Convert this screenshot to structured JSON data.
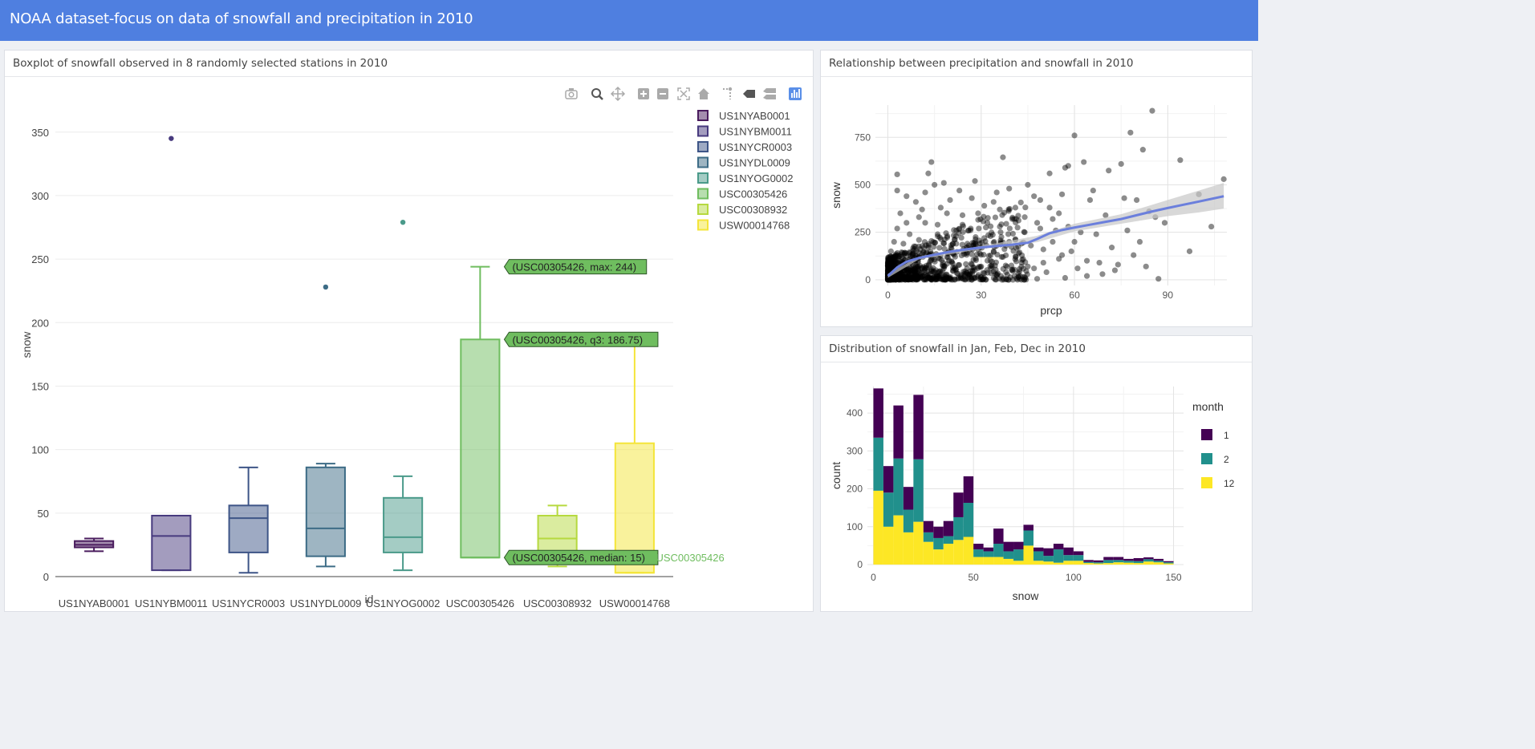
{
  "header": {
    "title": "NOAA dataset-focus on data of snowfall and precipitation in 2010"
  },
  "panels": {
    "boxplot": {
      "title": "Boxplot of snowfall observed in 8 randomly selected stations in 2010"
    },
    "scatter": {
      "title": "Relationship between precipitation and snowfall in 2010"
    },
    "histogram": {
      "title": "Distribution of snowfall in Jan, Feb, Dec in 2010"
    }
  },
  "modebar": {
    "buttons": [
      "camera-icon",
      "zoom-icon",
      "pan-icon",
      "zoom-in-icon",
      "zoom-out-icon",
      "autoscale-icon",
      "reset-axes-icon",
      "spike-lines-icon",
      "hover-closest-icon",
      "hover-compare-icon",
      "plotly-logo-icon"
    ]
  },
  "colors": {
    "navbar": "#4f7fe0",
    "smooth_line": "#6b7fdc",
    "ribbon": "#c8c8c8",
    "month_1": "#440154",
    "month_2": "#21908c",
    "month_12": "#fde725"
  },
  "chart_data": [
    {
      "type": "box",
      "xlabel": "id",
      "ylabel": "snow",
      "ylim": [
        0,
        365
      ],
      "yticks": [
        0,
        50,
        100,
        150,
        200,
        250,
        300,
        350
      ],
      "categories": [
        "US1NYAB0001",
        "US1NYBM0011",
        "US1NYCR0003",
        "US1NYDL0009",
        "US1NYOG0002",
        "USC00305426",
        "USC00308932",
        "USW00014768"
      ],
      "legend_position": "top-right",
      "series": [
        {
          "name": "US1NYAB0001",
          "min": 20,
          "q1": 23,
          "median": 25,
          "q3": 28,
          "max": 30,
          "outliers": [],
          "color": "#4a1c5e"
        },
        {
          "name": "US1NYBM0011",
          "min": 5,
          "q1": 5,
          "median": 32,
          "q3": 48,
          "max": 48,
          "outliers": [
            345
          ],
          "color": "#473a7e"
        },
        {
          "name": "US1NYCR0003",
          "min": 3,
          "q1": 19,
          "median": 46,
          "q3": 56,
          "max": 86,
          "outliers": [],
          "color": "#3e5587"
        },
        {
          "name": "US1NYDL0009",
          "min": 8,
          "q1": 16,
          "median": 38,
          "q3": 86,
          "max": 89,
          "outliers": [
            228
          ],
          "color": "#3d6c86"
        },
        {
          "name": "US1NYOG0002",
          "min": 5,
          "q1": 19,
          "median": 31,
          "q3": 62,
          "max": 79,
          "outliers": [
            279
          ],
          "color": "#4a9a8a"
        },
        {
          "name": "USC00305426",
          "min": 15,
          "q1": 15,
          "median": 15,
          "q3": 186.75,
          "max": 244,
          "outliers": [],
          "color": "#6fbd5f"
        },
        {
          "name": "USC00308932",
          "min": 8,
          "q1": 11,
          "median": 30,
          "q3": 48,
          "max": 56,
          "outliers": [],
          "color": "#b6d93f"
        },
        {
          "name": "USW00014768",
          "min": 3,
          "q1": 3,
          "median": 3,
          "q3": 105,
          "max": 185,
          "outliers": [],
          "color": "#f4e53a"
        }
      ],
      "hover_labels": [
        {
          "text": "(USC00305426, max: 244)",
          "value": 244
        },
        {
          "text": "(USC00305426, q3: 186.75)",
          "value": 186.75
        },
        {
          "text": "(USC00305426, median: 15)",
          "value": 15
        }
      ],
      "hover_axis_label": "USC00305426"
    },
    {
      "type": "scatter",
      "xlabel": "prcp",
      "ylabel": "snow",
      "xlim": [
        -4,
        109
      ],
      "ylim": [
        -30,
        920
      ],
      "xticks": [
        0,
        30,
        60,
        90
      ],
      "yticks": [
        0,
        250,
        500,
        750
      ],
      "points": [
        [
          3,
          555
        ],
        [
          14,
          620
        ],
        [
          37,
          645
        ],
        [
          85,
          890
        ],
        [
          60,
          760
        ],
        [
          78,
          775
        ],
        [
          82,
          685
        ],
        [
          94,
          630
        ],
        [
          108,
          530
        ],
        [
          104,
          280
        ],
        [
          97,
          150
        ],
        [
          87,
          5
        ],
        [
          80,
          420
        ],
        [
          63,
          620
        ],
        [
          58,
          600
        ],
        [
          71,
          575
        ],
        [
          75,
          610
        ],
        [
          66,
          470
        ],
        [
          57,
          590
        ],
        [
          52,
          560
        ],
        [
          49,
          420
        ],
        [
          45,
          500
        ],
        [
          41,
          380
        ],
        [
          35,
          460
        ],
        [
          32,
          300
        ],
        [
          28,
          520
        ],
        [
          24,
          340
        ],
        [
          20,
          420
        ],
        [
          17,
          380
        ],
        [
          12,
          460
        ],
        [
          9,
          410
        ],
        [
          6,
          300
        ],
        [
          4,
          350
        ],
        [
          2,
          200
        ],
        [
          1,
          150
        ],
        [
          3,
          60
        ],
        [
          5,
          90
        ],
        [
          8,
          130
        ],
        [
          10,
          210
        ],
        [
          13,
          170
        ],
        [
          16,
          240
        ],
        [
          19,
          120
        ],
        [
          22,
          190
        ],
        [
          26,
          260
        ],
        [
          29,
          160
        ],
        [
          31,
          220
        ],
        [
          33,
          100
        ],
        [
          36,
          280
        ],
        [
          39,
          200
        ],
        [
          42,
          140
        ],
        [
          44,
          250
        ],
        [
          46,
          180
        ],
        [
          48,
          300
        ],
        [
          50,
          90
        ],
        [
          53,
          200
        ],
        [
          55,
          350
        ],
        [
          59,
          150
        ],
        [
          61,
          60
        ],
        [
          64,
          100
        ],
        [
          67,
          240
        ],
        [
          69,
          30
        ],
        [
          72,
          170
        ],
        [
          74,
          80
        ],
        [
          77,
          260
        ],
        [
          79,
          130
        ],
        [
          81,
          200
        ],
        [
          83,
          70
        ],
        [
          86,
          330
        ],
        [
          89,
          300
        ],
        [
          100,
          450
        ],
        [
          62,
          250
        ],
        [
          56,
          130
        ],
        [
          47,
          60
        ],
        [
          38,
          40
        ],
        [
          27,
          80
        ],
        [
          18,
          60
        ],
        [
          11,
          20
        ],
        [
          7,
          10
        ],
        [
          2,
          30
        ],
        [
          0,
          5
        ],
        [
          1,
          80
        ],
        [
          4,
          40
        ],
        [
          6,
          140
        ],
        [
          9,
          70
        ],
        [
          14,
          110
        ],
        [
          21,
          50
        ],
        [
          25,
          30
        ],
        [
          30,
          70
        ],
        [
          34,
          150
        ],
        [
          40,
          320
        ],
        [
          43,
          90
        ],
        [
          51,
          40
        ],
        [
          54,
          260
        ],
        [
          65,
          420
        ],
        [
          70,
          340
        ],
        [
          76,
          430
        ],
        [
          84,
          360
        ],
        [
          15,
          500
        ],
        [
          23,
          470
        ],
        [
          27,
          430
        ],
        [
          31,
          390
        ],
        [
          36,
          370
        ],
        [
          44,
          330
        ],
        [
          49,
          270
        ],
        [
          53,
          320
        ],
        [
          58,
          280
        ],
        [
          12,
          300
        ],
        [
          7,
          240
        ],
        [
          3,
          270
        ],
        [
          5,
          190
        ],
        [
          2,
          110
        ],
        [
          8,
          50
        ],
        [
          10,
          330
        ],
        [
          16,
          290
        ],
        [
          19,
          350
        ],
        [
          22,
          260
        ],
        [
          26,
          180
        ],
        [
          33,
          230
        ],
        [
          37,
          120
        ],
        [
          41,
          210
        ],
        [
          45,
          70
        ],
        [
          50,
          160
        ],
        [
          55,
          110
        ],
        [
          60,
          200
        ],
        [
          68,
          90
        ],
        [
          73,
          50
        ],
        [
          15,
          15
        ],
        [
          20,
          5
        ],
        [
          28,
          10
        ],
        [
          35,
          25
        ],
        [
          42,
          15
        ],
        [
          48,
          5
        ],
        [
          57,
          10
        ],
        [
          64,
          20
        ],
        [
          3,
          470
        ],
        [
          6,
          440
        ],
        [
          11,
          370
        ],
        [
          13,
          560
        ],
        [
          18,
          510
        ],
        [
          24,
          290
        ],
        [
          29,
          350
        ],
        [
          34,
          410
        ],
        [
          39,
          480
        ],
        [
          47,
          440
        ],
        [
          52,
          380
        ],
        [
          56,
          450
        ]
      ],
      "smooth_line": [
        [
          0,
          20
        ],
        [
          3,
          65
        ],
        [
          6,
          95
        ],
        [
          10,
          115
        ],
        [
          15,
          132
        ],
        [
          20,
          148
        ],
        [
          25,
          160
        ],
        [
          30,
          170
        ],
        [
          35,
          178
        ],
        [
          40,
          185
        ],
        [
          45,
          195
        ],
        [
          48,
          215
        ],
        [
          52,
          245
        ],
        [
          56,
          262
        ],
        [
          60,
          275
        ],
        [
          65,
          290
        ],
        [
          70,
          305
        ],
        [
          75,
          320
        ],
        [
          80,
          340
        ],
        [
          85,
          360
        ],
        [
          90,
          378
        ],
        [
          95,
          395
        ],
        [
          100,
          412
        ],
        [
          108,
          440
        ]
      ],
      "ribbon": [
        [
          0,
          10,
          32
        ],
        [
          10,
          108,
          122
        ],
        [
          30,
          162,
          178
        ],
        [
          48,
          198,
          232
        ],
        [
          60,
          255,
          295
        ],
        [
          75,
          295,
          345
        ],
        [
          90,
          335,
          420
        ],
        [
          100,
          355,
          470
        ],
        [
          108,
          375,
          510
        ]
      ]
    },
    {
      "type": "bar",
      "stacked": true,
      "xlabel": "snow",
      "ylabel": "count",
      "xlim": [
        -3,
        155
      ],
      "ylim": [
        0,
        470
      ],
      "xticks": [
        0,
        50,
        100,
        150
      ],
      "yticks": [
        0,
        100,
        200,
        300,
        400
      ],
      "legend_title": "month",
      "legend_position": "right",
      "bin_width": 5,
      "bin_starts": [
        2.5,
        7.5,
        12.5,
        17.5,
        22.5,
        27.5,
        32.5,
        37.5,
        42.5,
        47.5,
        52.5,
        57.5,
        62.5,
        67.5,
        72.5,
        77.5,
        82.5,
        87.5,
        92.5,
        97.5,
        102.5,
        107.5,
        112.5,
        117.5,
        122.5,
        127.5,
        132.5,
        137.5,
        142.5,
        147.5
      ],
      "series": [
        {
          "name": "1",
          "color": "#440154",
          "values": [
            130,
            70,
            140,
            60,
            170,
            30,
            30,
            40,
            65,
            70,
            15,
            10,
            40,
            25,
            20,
            15,
            10,
            20,
            15,
            20,
            10,
            5,
            5,
            8,
            8,
            5,
            8,
            5,
            5,
            3
          ]
        },
        {
          "name": "2",
          "color": "#21908c",
          "values": [
            140,
            90,
            150,
            60,
            165,
            25,
            30,
            20,
            60,
            90,
            20,
            15,
            35,
            20,
            30,
            40,
            25,
            15,
            35,
            15,
            15,
            3,
            3,
            8,
            6,
            5,
            5,
            6,
            4,
            3
          ]
        },
        {
          "name": "12",
          "color": "#fde725",
          "values": [
            195,
            100,
            130,
            85,
            113,
            60,
            40,
            55,
            65,
            73,
            20,
            20,
            20,
            15,
            10,
            50,
            10,
            8,
            5,
            10,
            10,
            4,
            3,
            4,
            6,
            5,
            4,
            8,
            6,
            3
          ]
        }
      ]
    }
  ]
}
